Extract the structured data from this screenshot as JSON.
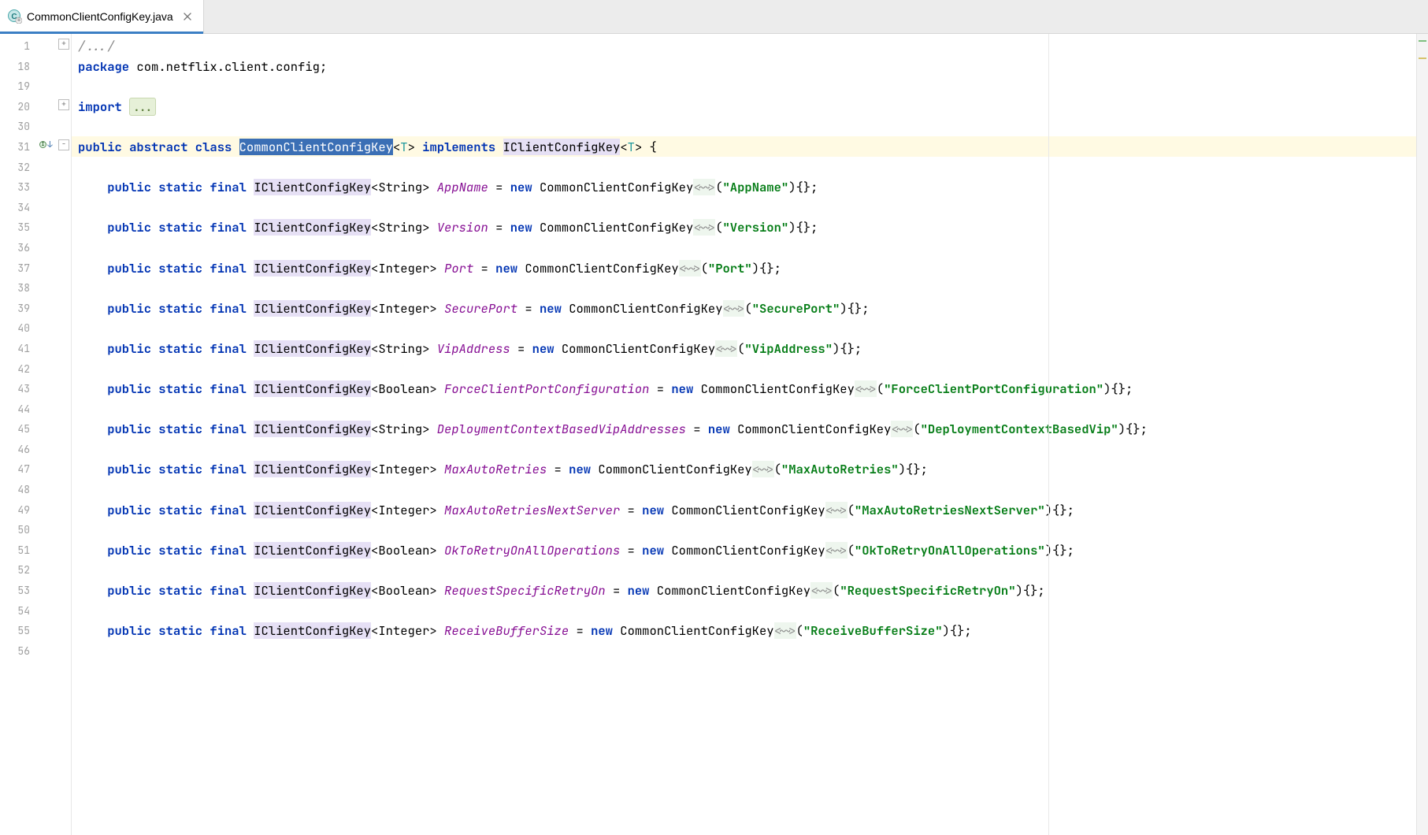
{
  "tab": {
    "title": "CommonClientConfigKey.java",
    "icon": "java-class-readonly-icon",
    "close": "×"
  },
  "colors": {
    "keyword": "#0033b3",
    "string": "#067d17",
    "field": "#871094",
    "tab_underline": "#3b7fc4"
  },
  "gutter_lines": [
    "1",
    "18",
    "19",
    "20",
    "30",
    "31",
    "32",
    "33",
    "34",
    "35",
    "36",
    "37",
    "38",
    "39",
    "40",
    "41",
    "42",
    "43",
    "44",
    "45",
    "46",
    "47",
    "48",
    "49",
    "50",
    "51",
    "52",
    "53",
    "54",
    "55",
    "56"
  ],
  "code": {
    "fold_header": "/.../",
    "package_kw": "package",
    "package_name": "com.netflix.client.config",
    "import_kw": "import",
    "import_fold": "...",
    "class_decl": {
      "mods": "public abstract class",
      "name": "CommonClientConfigKey",
      "tp": "T",
      "implements_kw": "implements",
      "iface": "IClientConfigKey",
      "iface_tp": "T"
    },
    "fields": [
      {
        "type": "String",
        "name": "AppName",
        "arg": "AppName"
      },
      {
        "type": "String",
        "name": "Version",
        "arg": "Version"
      },
      {
        "type": "Integer",
        "name": "Port",
        "arg": "Port"
      },
      {
        "type": "Integer",
        "name": "SecurePort",
        "arg": "SecurePort"
      },
      {
        "type": "String",
        "name": "VipAddress",
        "arg": "VipAddress"
      },
      {
        "type": "Boolean",
        "name": "ForceClientPortConfiguration",
        "arg": "ForceClientPortConfiguration"
      },
      {
        "type": "String",
        "name": "DeploymentContextBasedVipAddresses",
        "arg": "DeploymentContextBasedVip"
      },
      {
        "type": "Integer",
        "name": "MaxAutoRetries",
        "arg": "MaxAutoRetries"
      },
      {
        "type": "Integer",
        "name": "MaxAutoRetriesNextServer",
        "arg": "MaxAutoRetriesNextServer"
      },
      {
        "type": "Boolean",
        "name": "OkToRetryOnAllOperations",
        "arg": "OkToRetryOnAllOperations"
      },
      {
        "type": "Boolean",
        "name": "RequestSpecificRetryOn",
        "arg": "RequestSpecificRetryOn"
      },
      {
        "type": "Integer",
        "name": "ReceiveBufferSize",
        "arg": "ReceiveBufferSize"
      }
    ],
    "field_mods": "public static final",
    "iclient": "IClientConfigKey",
    "new_kw": "new",
    "ccck": "CommonClientConfigKey",
    "diamond_hint": "<~>"
  }
}
